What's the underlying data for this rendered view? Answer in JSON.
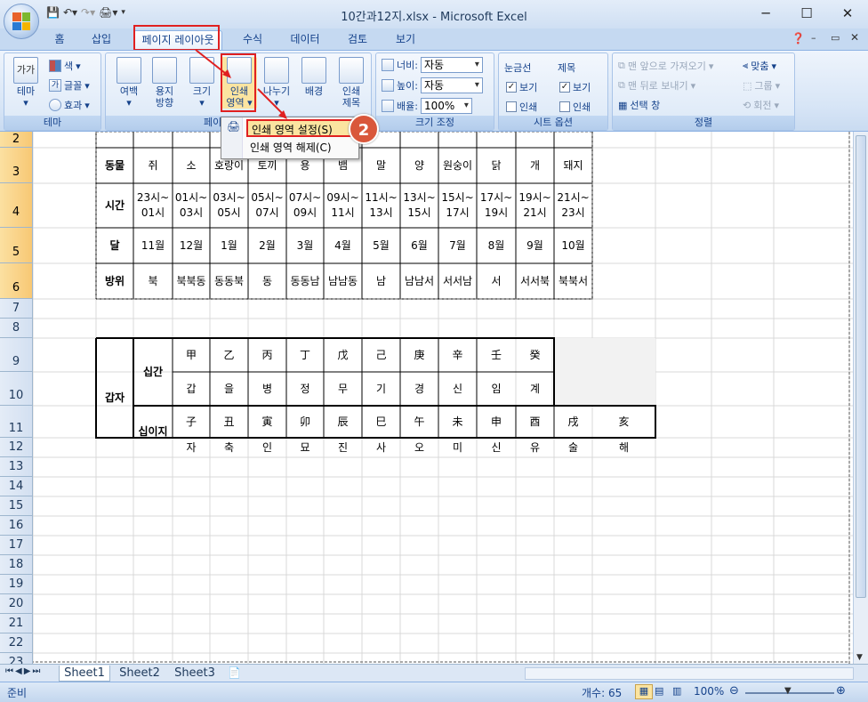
{
  "window": {
    "title": "10간과12지.xlsx - Microsoft Excel",
    "minimize": "─",
    "maximize": "☐",
    "close": "✕"
  },
  "tabs": [
    "홈",
    "삽입",
    "페이지 레이아웃",
    "수식",
    "데이터",
    "검토",
    "보기"
  ],
  "ribbon": {
    "theme_group": {
      "label": "테마",
      "theme": "테마",
      "colors": "색",
      "fonts": "글꼴",
      "effects": "효과",
      "icon_text": "가가"
    },
    "page_setup_group": {
      "label": "페이지 설정",
      "margins": "여백",
      "orientation": "용지\n방향",
      "size": "크기",
      "print_area": "인쇄\n영역",
      "breaks": "나누기",
      "background": "배경",
      "print_titles": "인쇄\n제목"
    },
    "scale_group": {
      "label": "크기 조정",
      "width_label": "너비:",
      "width_value": "자동",
      "height_label": "높이:",
      "height_value": "자동",
      "scale_label": "배율:",
      "scale_value": "100%"
    },
    "sheet_options_group": {
      "label": "시트 옵션",
      "gridlines": "눈금선",
      "headings": "제목",
      "view": "보기",
      "print": "인쇄"
    },
    "arrange_group": {
      "label": "정렬",
      "bring_front": "맨 앞으로 가져오기",
      "send_back": "맨 뒤로 보내기",
      "selection_pane": "선택 창",
      "align": "맞춤",
      "group": "그룹",
      "rotate": "회전"
    }
  },
  "dropdown": {
    "set_print_area": "인쇄 영역 설정(S)",
    "clear_print_area": "인쇄 영역 해제(C)"
  },
  "callout_number": "2",
  "rows": [
    "2",
    "3",
    "4",
    "5",
    "6",
    "7",
    "8",
    "9",
    "10",
    "11",
    "12",
    "13",
    "14",
    "15",
    "16",
    "17",
    "18",
    "19",
    "20",
    "21",
    "22",
    "23"
  ],
  "table1": {
    "animal_label": "동물",
    "animals": [
      "쥐",
      "소",
      "호랑이",
      "토끼",
      "용",
      "뱀",
      "말",
      "양",
      "원숭이",
      "닭",
      "개",
      "돼지"
    ],
    "time_label": "시간",
    "times": [
      "23시~\n01시",
      "01시~\n03시",
      "03시~\n05시",
      "05시~\n07시",
      "07시~\n09시",
      "09시~\n11시",
      "11시~\n13시",
      "13시~\n15시",
      "15시~\n17시",
      "17시~\n19시",
      "19시~\n21시",
      "21시~\n23시"
    ],
    "month_label": "달",
    "months": [
      "11월",
      "12월",
      "1월",
      "2월",
      "3월",
      "4월",
      "5월",
      "6월",
      "7월",
      "8월",
      "9월",
      "10월"
    ],
    "direction_label": "방위",
    "directions": [
      "북",
      "북북동",
      "동동북",
      "동",
      "동동남",
      "남남동",
      "남",
      "남남서",
      "서서남",
      "서",
      "서서북",
      "북북서"
    ]
  },
  "table2": {
    "ganja_label": "갑자",
    "sipgan_label": "십간",
    "sipgan_hanja": [
      "甲",
      "乙",
      "丙",
      "丁",
      "戊",
      "己",
      "庚",
      "辛",
      "壬",
      "癸"
    ],
    "sipgan_hangul": [
      "갑",
      "을",
      "병",
      "정",
      "무",
      "기",
      "경",
      "신",
      "임",
      "계"
    ],
    "sibiji_label": "십이지",
    "sibiji_hanja": [
      "子",
      "丑",
      "寅",
      "卯",
      "辰",
      "巳",
      "午",
      "未",
      "申",
      "酉",
      "戌",
      "亥"
    ],
    "sibiji_hangul": [
      "자",
      "축",
      "인",
      "묘",
      "진",
      "사",
      "오",
      "미",
      "신",
      "유",
      "술",
      "해"
    ]
  },
  "sheets": [
    "Sheet1",
    "Sheet2",
    "Sheet3"
  ],
  "status": {
    "ready": "준비",
    "count": "개수: 65",
    "zoom": "100%"
  }
}
